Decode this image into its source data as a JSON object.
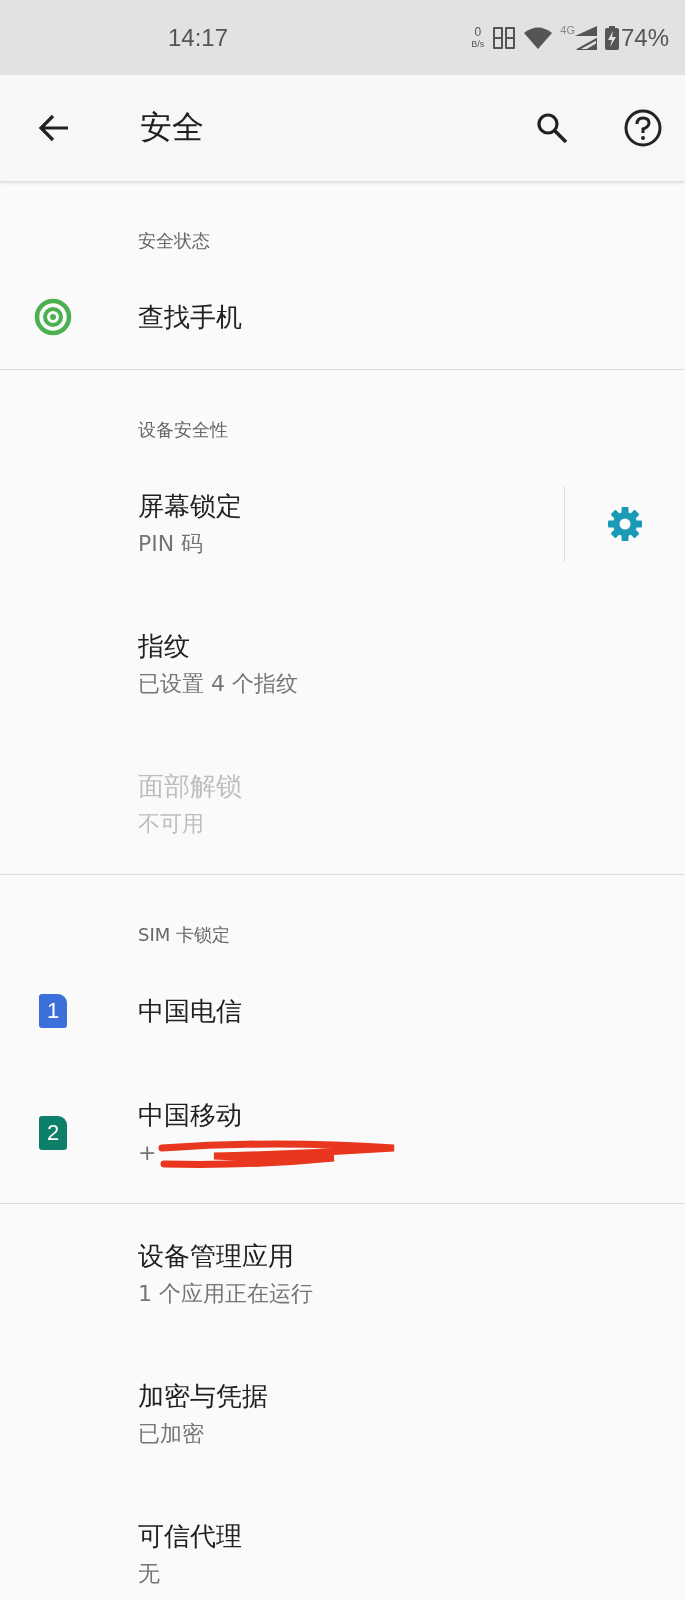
{
  "status_bar": {
    "time": "14:17",
    "net_speed_value": "0",
    "net_speed_unit": "B/s",
    "network_type": "4G",
    "battery": "74%"
  },
  "toolbar": {
    "title": "安全"
  },
  "sections": [
    {
      "header": "安全状态",
      "items": [
        {
          "title": "查找手机",
          "kind": "target",
          "disabled": false,
          "settings_button": false
        }
      ]
    },
    {
      "header": "设备安全性",
      "items": [
        {
          "title": "屏幕锁定",
          "summary": "PIN 码",
          "disabled": false,
          "settings_button": true
        },
        {
          "title": "指纹",
          "summary": "已设置 4 个指纹",
          "disabled": false,
          "settings_button": false
        },
        {
          "title": "面部解锁",
          "summary": "不可用",
          "disabled": true,
          "settings_button": false
        }
      ]
    },
    {
      "header": "SIM 卡锁定",
      "items": [
        {
          "title": "中国电信",
          "kind": "sim",
          "sim_number": "1",
          "color": "#3b6fd9",
          "disabled": false,
          "settings_button": false
        },
        {
          "title": "中国移动",
          "kind": "sim",
          "sim_number": "2",
          "color": "#0e7f69",
          "summary": "+",
          "redacted": true,
          "disabled": false,
          "settings_button": false
        }
      ]
    },
    {
      "items": [
        {
          "title": "设备管理应用",
          "summary": "1 个应用正在运行",
          "disabled": false,
          "settings_button": false
        },
        {
          "title": "加密与凭据",
          "summary": "已加密",
          "disabled": false,
          "settings_button": false
        },
        {
          "title": "可信代理",
          "summary": "无",
          "disabled": false,
          "settings_button": false
        }
      ]
    }
  ]
}
